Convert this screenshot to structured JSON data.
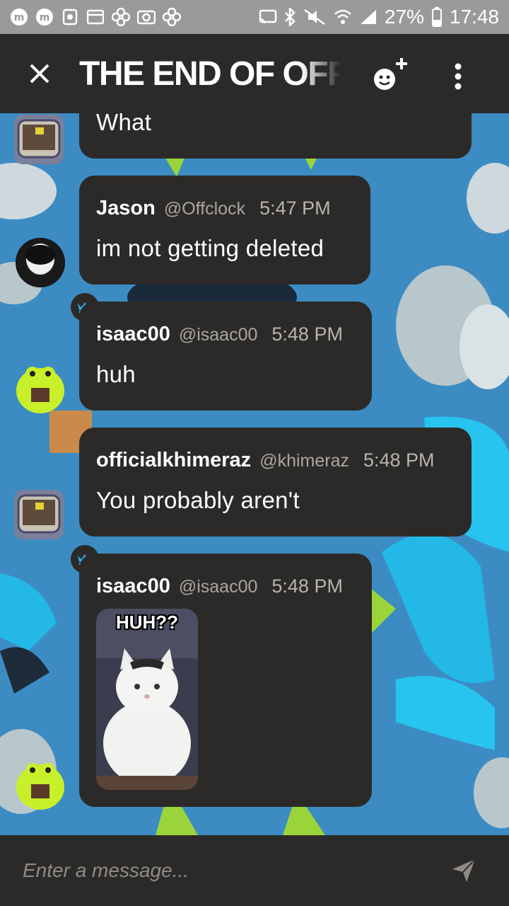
{
  "status_bar": {
    "battery": "27%",
    "time": "17:48"
  },
  "app_bar": {
    "title": "THE END OF OFF"
  },
  "messages": [
    {
      "text": "What"
    },
    {
      "username": "Jason",
      "handle": "@Offclock",
      "time": "5:47 PM",
      "text": "im not getting deleted"
    },
    {
      "username": "isaac00",
      "handle": "@isaac00",
      "time": "5:48 PM",
      "text": "huh"
    },
    {
      "username": "officialkhimeraz",
      "handle": "@khimeraz",
      "time": "5:48 PM",
      "text": "You probably aren't"
    },
    {
      "username": "isaac00",
      "handle": "@isaac00",
      "time": "5:48 PM",
      "image_caption": "HUH??"
    }
  ],
  "composer": {
    "placeholder": "Enter a message..."
  },
  "colors": {
    "bubble": "#2c2a28",
    "app_bar": "#2c2a28",
    "background": "#3b8bc2",
    "accent_badge": "#2aa7e8"
  }
}
